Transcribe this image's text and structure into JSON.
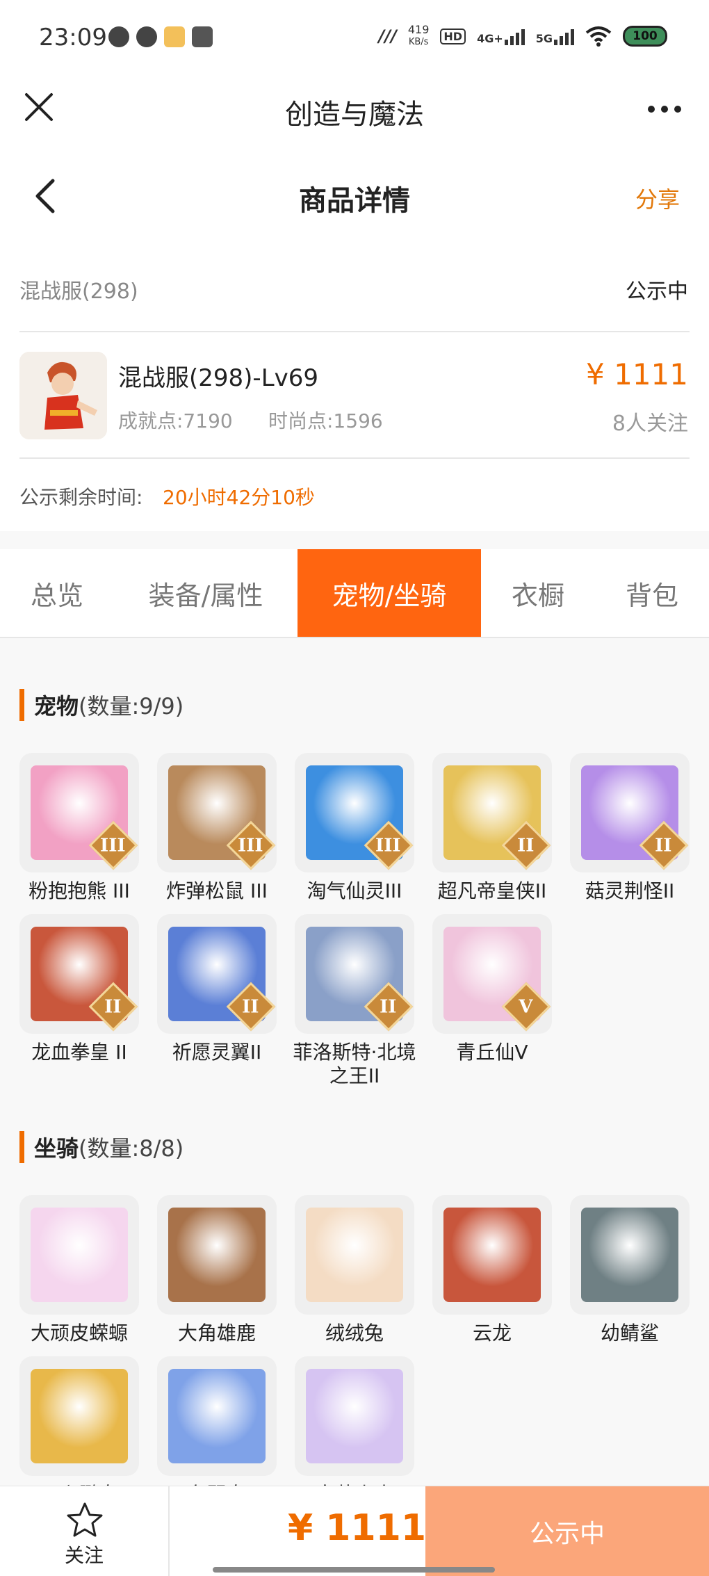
{
  "status_bar": {
    "time": "23:09",
    "net_speed_value": "419",
    "net_speed_unit": "KB/s",
    "hd": "HD",
    "sim1": "4G+",
    "sim2": "5G",
    "battery": "100",
    "icons": [
      "message-icon",
      "wechat-icon",
      "app-badge-icon",
      "android-icon"
    ]
  },
  "titlebar": {
    "title": "创造与魔法"
  },
  "page_header": {
    "title": "商品详情",
    "share_label": "分享"
  },
  "product": {
    "server": "混战服(298)",
    "status": "公示中",
    "name": "混战服(298)-Lv69",
    "achievement": "成就点:7190",
    "fashion": "时尚点:1596",
    "price": "¥ 1111",
    "followers": "8人关注",
    "remain_label": "公示剩余时间:",
    "remain_value": "20小时42分10秒"
  },
  "tabs": [
    {
      "label": "总览",
      "active": false
    },
    {
      "label": "装备/属性",
      "active": false
    },
    {
      "label": "宠物/坐骑",
      "active": true
    },
    {
      "label": "衣橱",
      "active": false
    },
    {
      "label": "背包",
      "active": false
    }
  ],
  "pets": {
    "title": "宠物",
    "count": "(数量:9/9)",
    "items": [
      {
        "label": "粉抱抱熊 III",
        "tier": "III",
        "color": "#f2a1c4"
      },
      {
        "label": "炸弹松鼠 III",
        "tier": "III",
        "color": "#b98a5c"
      },
      {
        "label": "淘气仙灵III",
        "tier": "III",
        "color": "#3d8fe0"
      },
      {
        "label": "超凡帝皇侠II",
        "tier": "II",
        "color": "#e6c25a"
      },
      {
        "label": "菇灵荆怪II",
        "tier": "II",
        "color": "#b58ee8"
      },
      {
        "label": "龙血拳皇 II",
        "tier": "II",
        "color": "#c9573c"
      },
      {
        "label": "祈愿灵翼II",
        "tier": "II",
        "color": "#5b7fd6"
      },
      {
        "label": "菲洛斯特·北境之王II",
        "tier": "II",
        "color": "#8aa0c8"
      },
      {
        "label": "青丘仙V",
        "tier": "V",
        "color": "#f0c4dc"
      }
    ]
  },
  "mounts": {
    "title": "坐骑",
    "count": "(数量:8/8)",
    "items": [
      {
        "label": "大顽皮蝾螈",
        "color": "#f5d6ee"
      },
      {
        "label": "大角雄鹿",
        "color": "#a8724a"
      },
      {
        "label": "绒绒兔",
        "color": "#f4dcc4"
      },
      {
        "label": "云龙",
        "color": "#c8563c"
      },
      {
        "label": "幼鲭鲨",
        "color": "#6f8084"
      },
      {
        "label": "云斑鹦鸟",
        "color": "#e8b84a"
      },
      {
        "label": "冬翼鸟",
        "color": "#7fa2e8"
      },
      {
        "label": "白蒙小鹿",
        "color": "#d6c4f2"
      }
    ]
  },
  "bottom_bar": {
    "follow_label": "关注",
    "price": "¥ 1111",
    "cta_label": "公示中"
  }
}
